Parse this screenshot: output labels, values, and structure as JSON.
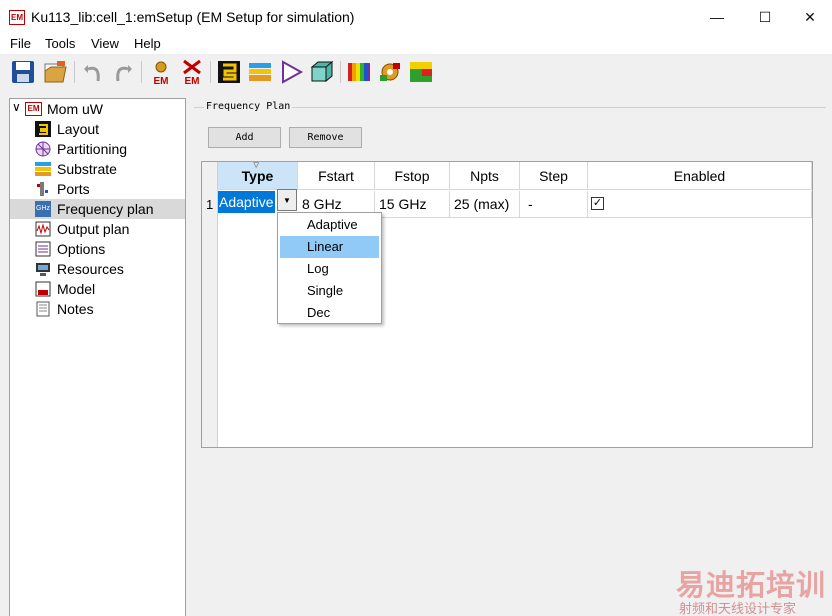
{
  "window": {
    "app_icon_text": "EM",
    "title": "Ku113_lib:cell_1:emSetup (EM Setup for simulation)",
    "minimize_symbol": "—",
    "maximize_symbol": "☐",
    "close_symbol": "✕"
  },
  "menu": [
    "File",
    "Tools",
    "View",
    "Help"
  ],
  "toolbar": {
    "icons": [
      "save-icon",
      "open-folder-icon",
      "undo-icon",
      "redo-icon",
      "em-simulate-icon",
      "em-stop-icon",
      "layout-icon",
      "substrate-icon",
      "ports-icon",
      "3d-view-icon",
      "colorbar-icon",
      "ports-config-icon",
      "visualization-icon"
    ],
    "em_label": "EM"
  },
  "tree": {
    "root": {
      "label": "Mom uW",
      "icon": "em-icon",
      "icon_text": "EM",
      "expander": "∨"
    },
    "items": [
      {
        "label": "Layout",
        "icon": "layout-icon"
      },
      {
        "label": "Partitioning",
        "icon": "partitioning-icon"
      },
      {
        "label": "Substrate",
        "icon": "substrate-icon"
      },
      {
        "label": "Ports",
        "icon": "ports-icon"
      },
      {
        "label": "Frequency plan",
        "icon": "frequency-icon",
        "icon_text": "GHz",
        "selected": true
      },
      {
        "label": "Output plan",
        "icon": "output-plan-icon"
      },
      {
        "label": "Options",
        "icon": "options-icon"
      },
      {
        "label": "Resources",
        "icon": "resources-icon"
      },
      {
        "label": "Model",
        "icon": "model-icon"
      },
      {
        "label": "Notes",
        "icon": "notes-icon"
      }
    ]
  },
  "frequency_plan": {
    "group_title": "Frequency Plan",
    "add_label": "Add",
    "remove_label": "Remove",
    "columns": [
      "Type",
      "Fstart",
      "Fstop",
      "Npts",
      "Step",
      "Enabled"
    ],
    "sort_caret": "▽",
    "rows": [
      {
        "num": "1",
        "type": "Adaptive",
        "fstart": "8 GHz",
        "fstop": "15 GHz",
        "npts": "25 (max)",
        "step": "-",
        "enabled": "✓"
      }
    ],
    "combo_arrow": "▼",
    "type_options": [
      "Adaptive",
      "Linear",
      "Log",
      "Single",
      "Dec"
    ],
    "highlighted_option": "Linear"
  },
  "watermark": {
    "line1": "易迪拓培训",
    "line2": "射频和天线设计专家"
  }
}
